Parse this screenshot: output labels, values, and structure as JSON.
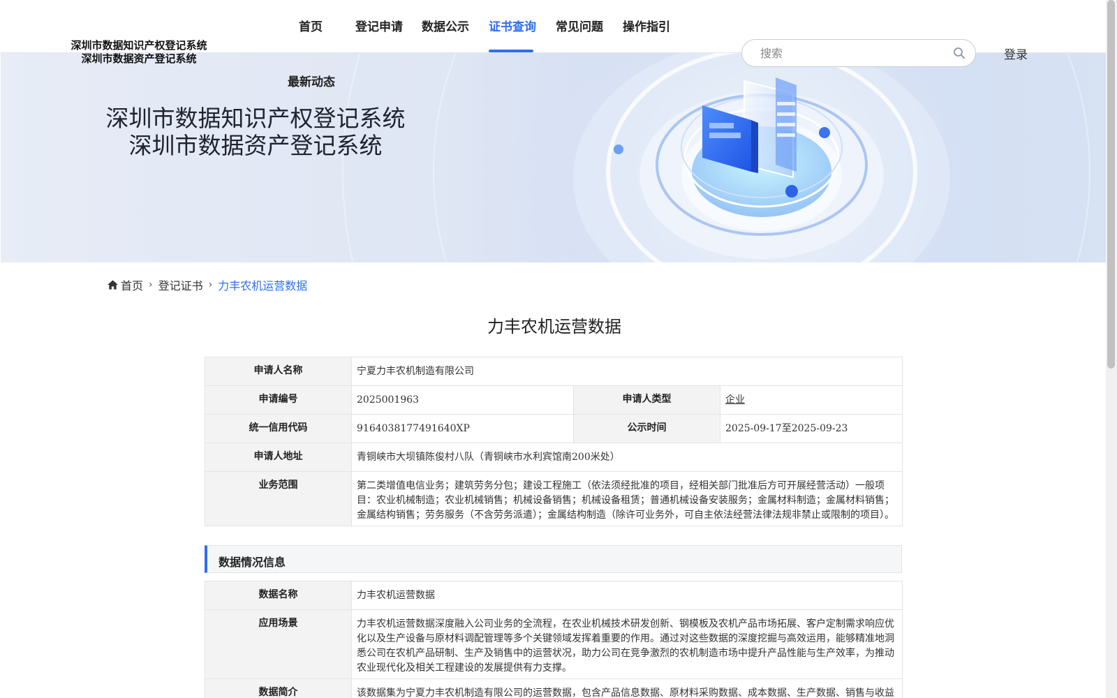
{
  "header": {
    "logo_line1": "深圳市数据知识产权登记系统",
    "logo_line2": "深圳市数据资产登记系统",
    "nav": [
      "首页",
      "登记申请",
      "数据公示",
      "证书查询",
      "常见问题",
      "操作指引",
      "最新动态"
    ],
    "active_nav": "证书查询",
    "search_placeholder": "搜索",
    "search_icon": "search-icon",
    "login_label": "登录"
  },
  "banner": {
    "title_line1": "深圳市数据知识产权登记系统",
    "title_line2": "深圳市数据资产登记系统"
  },
  "breadcrumb": {
    "home_icon": "home-icon",
    "home": "首页",
    "level2": "登记证书",
    "current": "力丰农机运营数据"
  },
  "page_title": "力丰农机运营数据",
  "applicant": {
    "name_label": "申请人名称",
    "name": "宁夏力丰农机制造有限公司",
    "number_label": "申请编号",
    "number": "2025001963",
    "type_label": "申请人类型",
    "type": "企业",
    "credit_label": "统一信用代码",
    "credit": "91640381774916­40XP",
    "publicity_label": "公示时间",
    "publicity": "2025-09-17至2025-09-23",
    "address_label": "申请人地址",
    "address": "青铜峡市大坝镇陈俊村八队（青铜峡市水利宾馆南200米处）",
    "scope_label": "业务范围",
    "scope": "第二类增值电信业务；建筑劳务分包；建设工程施工（依法须经批准的项目，经相关部门批准后方可开展经营活动）一般项目：农业机械制造；农业机械销售；机械设备销售；机械设备租赁；普通机械设备安装服务；金属材料制造；金属材料销售；金属结构销售；劳务服务（不含劳务派遣）；金属结构制造（除许可业务外，可自主依法经营法律法规非禁止或限制的项目）。"
  },
  "data_section": {
    "title": "数据情况信息",
    "name_label": "数据名称",
    "name": "力丰农机运营数据",
    "scene_label": "应用场景",
    "scene": "力丰农机运营数据深度融入公司业务的全流程，在农业机械技术研发创新、钢模板及农机产品市场拓展、客户定制需求响应优化以及生产设备与原材料调配管理等多个关键领域发挥着重要的作用。通过对这些数据的深度挖掘与高效运用，能够精准地洞悉公司在农机产品研制、生产及销售中的运营状况，助力公司在竞争激烈的农机制造市场中提升产品性能与生产效率，为推动农业现代化及相关工程建设的发展提供有力支撑。",
    "intro_label": "数据简介",
    "intro": "该数据集为宁夏力丰农机制造有限公司的运营数据，包含产品信息数据、原材料采购数据、成本数据、生产数据、销售与收益数据、客户反馈数据、库存管理数据等基础数据字段。数据完整呈现从农业机械原材料采购、生产加工到产品销售、库存管理"
  }
}
